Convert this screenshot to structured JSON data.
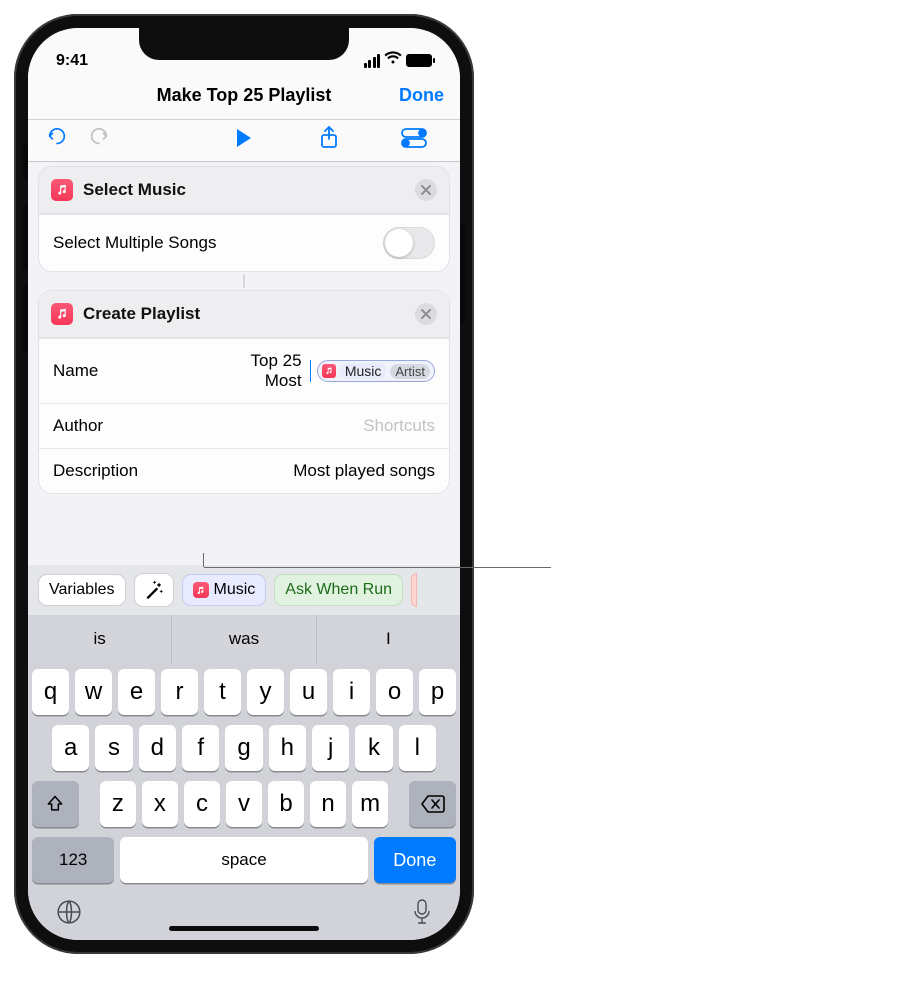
{
  "status": {
    "time": "9:41"
  },
  "nav": {
    "title": "Make Top 25 Playlist",
    "done": "Done"
  },
  "card1": {
    "title": "Select Music",
    "row1_label": "Select Multiple Songs"
  },
  "card2": {
    "title": "Create Playlist",
    "name_label": "Name",
    "name_value": "Top 25 Most",
    "token_main": "Music",
    "token_sub": "Artist",
    "author_label": "Author",
    "author_placeholder": "Shortcuts",
    "desc_label": "Description",
    "desc_value": "Most played songs"
  },
  "varbar": {
    "variables": "Variables",
    "music": "Music",
    "ask": "Ask When Run"
  },
  "suggest": {
    "a": "is",
    "b": "was",
    "c": "I"
  },
  "keys": {
    "r1": [
      "q",
      "w",
      "e",
      "r",
      "t",
      "y",
      "u",
      "i",
      "o",
      "p"
    ],
    "r2": [
      "a",
      "s",
      "d",
      "f",
      "g",
      "h",
      "j",
      "k",
      "l"
    ],
    "r3": [
      "z",
      "x",
      "c",
      "v",
      "b",
      "n",
      "m"
    ],
    "num": "123",
    "space": "space",
    "done": "Done"
  }
}
